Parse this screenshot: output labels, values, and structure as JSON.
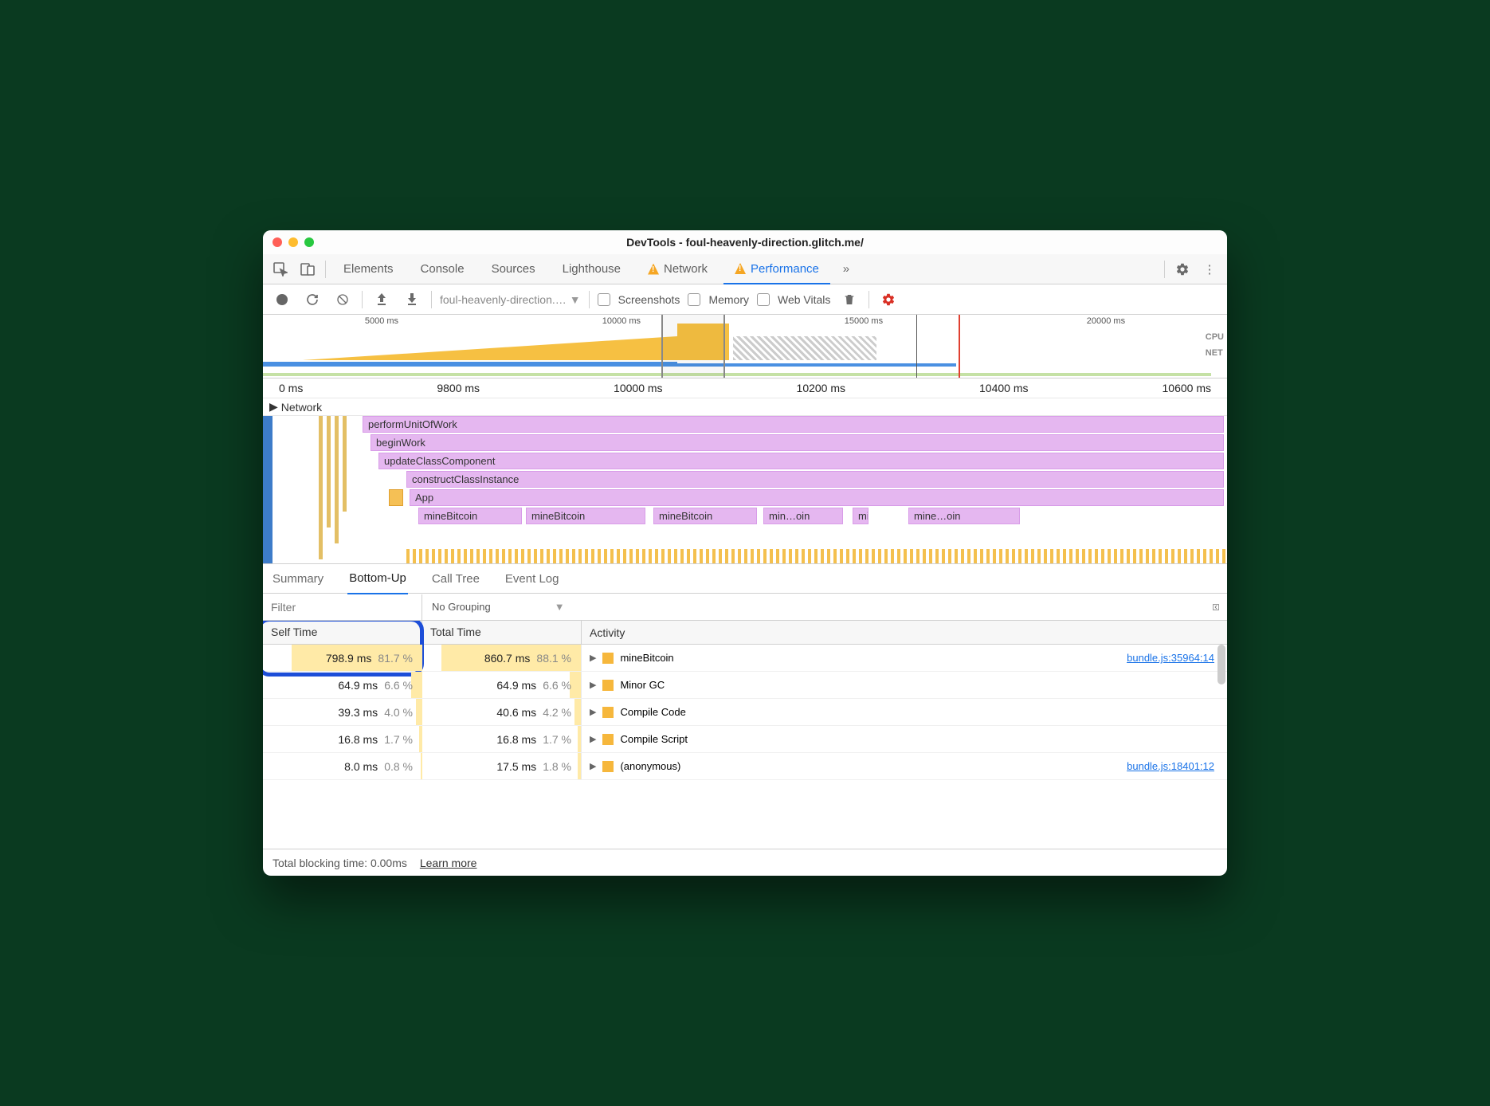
{
  "window": {
    "title": "DevTools - foul-heavenly-direction.glitch.me/"
  },
  "tabs": [
    "Elements",
    "Console",
    "Sources",
    "Lighthouse",
    "Network",
    "Performance"
  ],
  "activeTab": "Performance",
  "toolbar": {
    "recordingName": "foul-heavenly-direction.…",
    "checkboxes": {
      "screenshots": "Screenshots",
      "memory": "Memory",
      "webVitals": "Web Vitals"
    }
  },
  "overview": {
    "ticks": [
      "5000 ms",
      "10000 ms",
      "15000 ms",
      "20000 ms"
    ],
    "labels": [
      "CPU",
      "NET"
    ]
  },
  "timelineTicks": [
    "0 ms",
    "9800 ms",
    "10000 ms",
    "10200 ms",
    "10400 ms",
    "10600 ms"
  ],
  "networkRow": "Network",
  "flame": {
    "stack": [
      "performUnitOfWork",
      "beginWork",
      "updateClassComponent",
      "constructClassInstance",
      "App"
    ],
    "leaves": [
      "mineBitcoin",
      "mineBitcoin",
      "mineBitcoin",
      "min…oin",
      "mineBitcoin",
      "mine…oin"
    ]
  },
  "subtabs": [
    "Summary",
    "Bottom-Up",
    "Call Tree",
    "Event Log"
  ],
  "activeSubtab": "Bottom-Up",
  "filter": {
    "placeholder": "Filter",
    "grouping": "No Grouping"
  },
  "columns": {
    "self": "Self Time",
    "total": "Total Time",
    "activity": "Activity"
  },
  "rows": [
    {
      "selfMs": "798.9 ms",
      "selfPct": "81.7 %",
      "selfBar": 82,
      "totalMs": "860.7 ms",
      "totalPct": "88.1 %",
      "totalBar": 88,
      "activity": "mineBitcoin",
      "link": "bundle.js:35964:14"
    },
    {
      "selfMs": "64.9 ms",
      "selfPct": "6.6 %",
      "selfBar": 7,
      "totalMs": "64.9 ms",
      "totalPct": "6.6 %",
      "totalBar": 7,
      "activity": "Minor GC",
      "link": ""
    },
    {
      "selfMs": "39.3 ms",
      "selfPct": "4.0 %",
      "selfBar": 4,
      "totalMs": "40.6 ms",
      "totalPct": "4.2 %",
      "totalBar": 4,
      "activity": "Compile Code",
      "link": ""
    },
    {
      "selfMs": "16.8 ms",
      "selfPct": "1.7 %",
      "selfBar": 2,
      "totalMs": "16.8 ms",
      "totalPct": "1.7 %",
      "totalBar": 2,
      "activity": "Compile Script",
      "link": ""
    },
    {
      "selfMs": "8.0 ms",
      "selfPct": "0.8 %",
      "selfBar": 1,
      "totalMs": "17.5 ms",
      "totalPct": "1.8 %",
      "totalBar": 2,
      "activity": "(anonymous)",
      "link": "bundle.js:18401:12"
    }
  ],
  "status": {
    "blocking": "Total blocking time: 0.00ms",
    "learn": "Learn more"
  }
}
